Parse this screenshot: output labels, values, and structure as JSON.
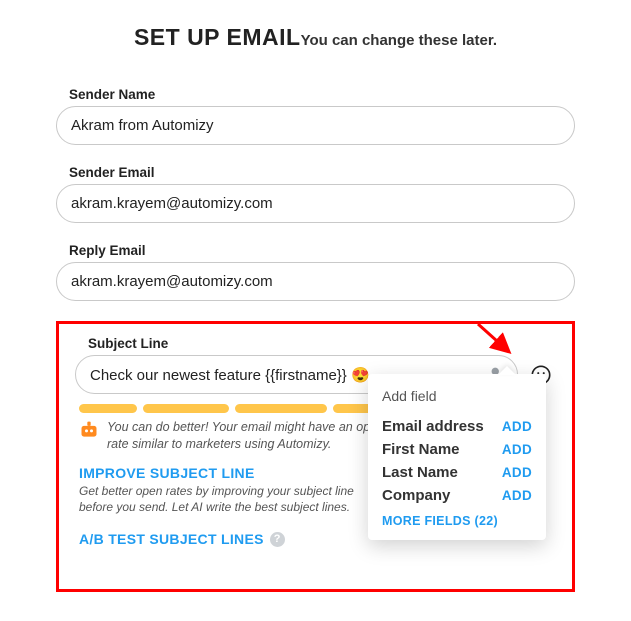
{
  "header": {
    "title": "SET UP EMAIL",
    "subtitle": "You can change these later."
  },
  "fields": {
    "sender_name": {
      "label": "Sender Name",
      "value": "Akram from Automizy"
    },
    "sender_email": {
      "label": "Sender Email",
      "value": "akram.krayem@automizy.com"
    },
    "reply_email": {
      "label": "Reply Email",
      "value": "akram.krayem@automizy.com"
    },
    "subject": {
      "label": "Subject Line",
      "value": "Check our newest feature {{firstname}} 😍"
    }
  },
  "tip": {
    "text": "You can do better! Your email might have an open rate similar to marketers using Automizy."
  },
  "improve": {
    "link": "IMPROVE SUBJECT LINE",
    "desc": "Get better open rates by improving your subject line before you send. Let AI write the best subject lines."
  },
  "ab": {
    "link": "A/B TEST SUBJECT LINES"
  },
  "popover": {
    "title": "Add field",
    "items": [
      {
        "name": "Email address",
        "action": "ADD"
      },
      {
        "name": "First Name",
        "action": "ADD"
      },
      {
        "name": "Last Name",
        "action": "ADD"
      },
      {
        "name": "Company",
        "action": "ADD"
      }
    ],
    "more": "MORE FIELDS (22)"
  }
}
